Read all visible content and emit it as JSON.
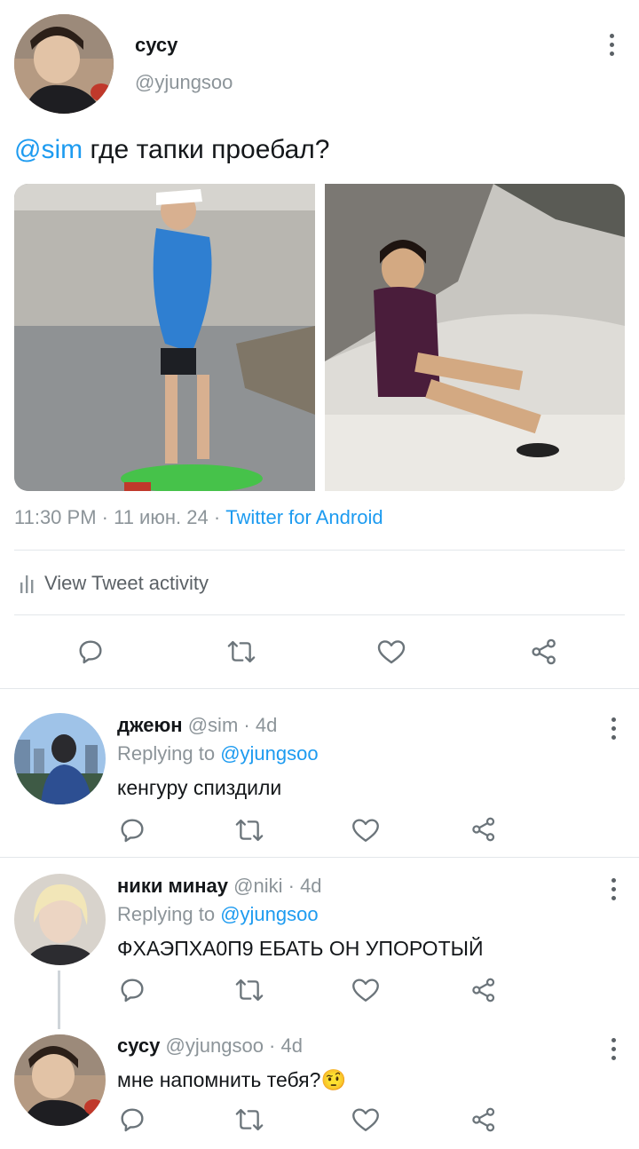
{
  "main_tweet": {
    "author_name": "сусу",
    "author_handle": "@yjungsoo",
    "mention": "@sim",
    "text": " где тапки проебал?",
    "time": "11:30 PM",
    "date": "11 июн. 24",
    "separator": " · ",
    "source": "Twitter for Android",
    "activity_label": "View Tweet activity"
  },
  "replies": [
    {
      "name": "джеюн",
      "handle": "@sim",
      "age": "4d",
      "replying_label": "Replying to",
      "replying_handle": "@yjungsoo",
      "text": "кенгуру спиздили"
    },
    {
      "name": "ники минау",
      "handle": "@niki",
      "age": "4d",
      "replying_label": "Replying to",
      "replying_handle": "@yjungsoo",
      "text": "ФХАЭПХА0П9 ЕБАТЬ ОН УПОРОТЫЙ"
    },
    {
      "name": "сусу",
      "handle": "@yjungsoo",
      "age": "4d",
      "text": "мне напомнить тебя?",
      "emoji": "🤨"
    }
  ],
  "colors": {
    "accent": "#1d9bf0",
    "muted": "#8c9499",
    "icon": "#6b747a",
    "divider": "#e3e7ea"
  },
  "icons": {
    "reply": "speech-bubble-icon",
    "retweet": "retweet-icon",
    "like": "heart-icon",
    "share": "share-icon",
    "more": "kebab-menu-icon",
    "activity": "bar-chart-icon"
  }
}
